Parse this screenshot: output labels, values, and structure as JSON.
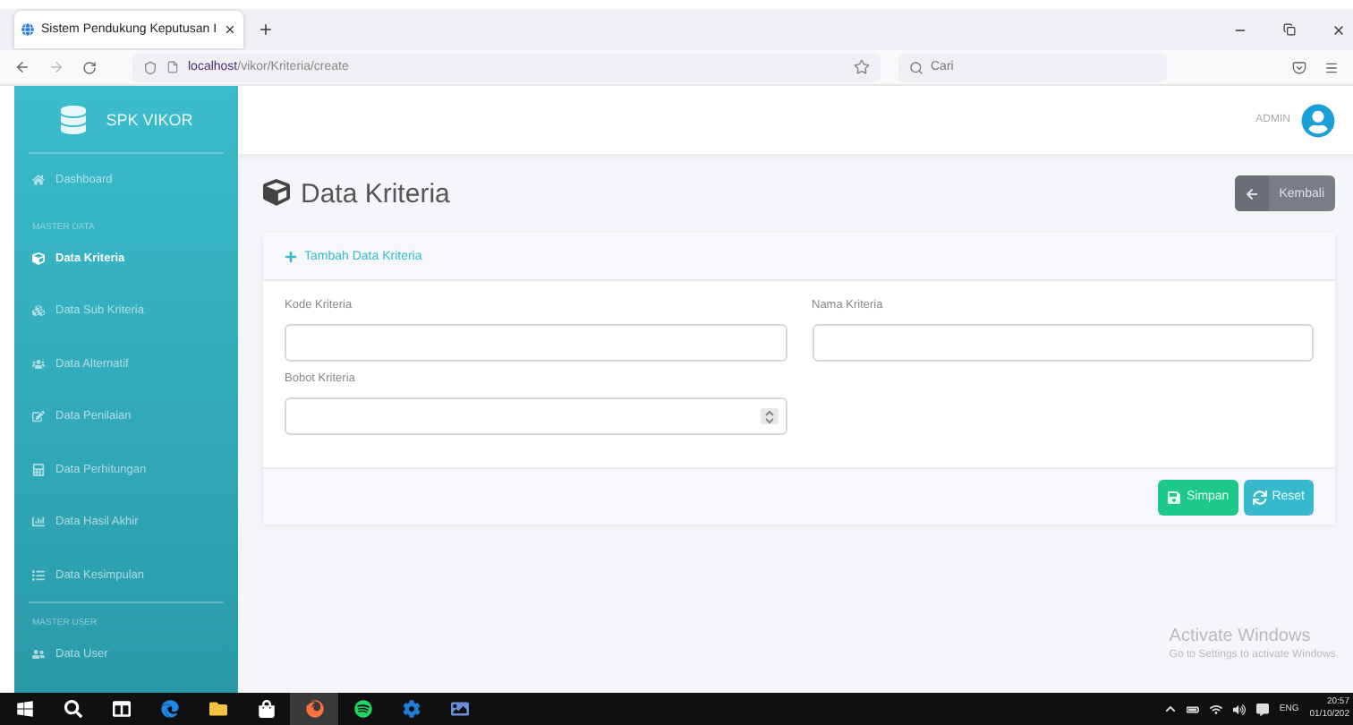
{
  "browser": {
    "tabs": [
      {
        "title": "Sistem Pendukung Keputusan I",
        "selected": true
      }
    ],
    "address": {
      "host": "localhost",
      "path": "/vikor/Kriteria/create"
    },
    "search": {
      "placeholder": "Cari"
    }
  },
  "sidebar": {
    "brand": "SPK VIKOR",
    "sections": [
      {
        "items": [
          {
            "label": "Dashboard",
            "selected": false
          }
        ]
      },
      {
        "heading": "MASTER DATA",
        "items": [
          {
            "label": "Data Kriteria",
            "selected": true
          },
          {
            "label": "Data Sub Kriteria",
            "selected": false
          },
          {
            "label": "Data Alternatif",
            "selected": false
          },
          {
            "label": "Data Penilaian",
            "selected": false
          },
          {
            "label": "Data Perhitungan",
            "selected": false
          },
          {
            "label": "Data Hasil Akhir",
            "selected": false
          },
          {
            "label": "Data Kesimpulan",
            "selected": false
          }
        ]
      },
      {
        "heading": "MASTER USER",
        "items": [
          {
            "label": "Data User",
            "selected": false
          }
        ]
      }
    ]
  },
  "topbar": {
    "user": "ADMIN"
  },
  "page": {
    "title": "Data Kriteria",
    "back_button": "Kembali"
  },
  "card": {
    "title": "Tambah Data Kriteria",
    "fields": [
      {
        "label": "Kode Kriteria",
        "kind": "text"
      },
      {
        "label": "Nama Kriteria",
        "kind": "text"
      },
      {
        "label": "Bobot Kriteria",
        "kind": "number"
      }
    ],
    "buttons": [
      {
        "label": "Simpan",
        "kind": "save"
      },
      {
        "label": "Reset",
        "kind": "reset"
      }
    ]
  },
  "activation": {
    "title": "Activate Windows",
    "subtitle": "Go to Settings to activate Windows."
  },
  "taskbar": {
    "apps": [
      {
        "active": false
      },
      {
        "active": false
      },
      {
        "active": false
      },
      {
        "active": false
      },
      {
        "active": false
      },
      {
        "active": false
      },
      {
        "active": true
      },
      {
        "active": false
      },
      {
        "active": false
      },
      {
        "active": false
      }
    ],
    "language": "ENG",
    "time": "20:57",
    "date": "01/10/202"
  }
}
